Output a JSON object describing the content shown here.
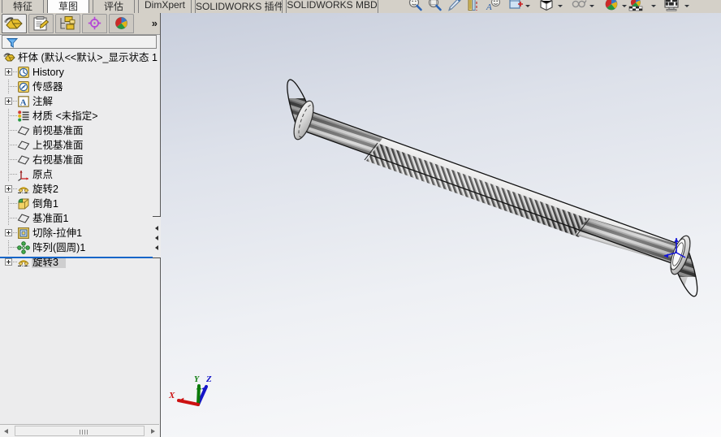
{
  "app": {
    "name": "SOLIDWORKS",
    "document_title": "杆体"
  },
  "command_tabs": [
    {
      "label": "特征",
      "active": false
    },
    {
      "label": "草图",
      "active": true
    },
    {
      "label": "评估",
      "active": false
    },
    {
      "label": "DimXpert",
      "active": false
    },
    {
      "label": "SOLIDWORKS 插件",
      "active": false
    },
    {
      "label": "SOLIDWORKS MBD",
      "active": false
    }
  ],
  "view_toolbar": [
    {
      "name": "zoom-to-fit-icon"
    },
    {
      "name": "zoom-to-area-icon"
    },
    {
      "name": "zoom-in-out-icon"
    },
    {
      "name": "section-view-icon"
    },
    {
      "name": "view-orientation-icon"
    },
    {
      "name": "display-style-icon",
      "has_dropdown": true
    },
    {
      "name": "hide-show-items-icon",
      "has_dropdown": true
    },
    {
      "name": "edit-appearance-icon",
      "has_dropdown": true
    },
    {
      "name": "apply-scene-icon",
      "has_dropdown": true
    },
    {
      "name": "view-settings-icon",
      "has_dropdown": true
    }
  ],
  "manager_tabs": [
    {
      "name": "feature-manager-tab",
      "selected": true
    },
    {
      "name": "property-manager-tab",
      "selected": false
    },
    {
      "name": "configuration-manager-tab",
      "selected": false
    },
    {
      "name": "dimxpert-manager-tab",
      "selected": false
    },
    {
      "name": "display-manager-tab",
      "selected": false
    }
  ],
  "manager_overflow_label": "»",
  "filter": {
    "value": "",
    "placeholder": ""
  },
  "tree": {
    "root": {
      "label": "杆体  (默认<<默认>_显示状态 1",
      "icon": "part-icon"
    },
    "items": [
      {
        "label": "History",
        "icon": "history-icon",
        "expandable": true,
        "depth": 1
      },
      {
        "label": "传感器",
        "icon": "sensors-icon",
        "expandable": false,
        "depth": 1
      },
      {
        "label": "注解",
        "icon": "annotations-icon",
        "expandable": true,
        "depth": 1
      },
      {
        "label": "材质 <未指定>",
        "icon": "material-icon",
        "expandable": false,
        "depth": 1
      },
      {
        "label": "前视基准面",
        "icon": "plane-icon",
        "expandable": false,
        "depth": 1
      },
      {
        "label": "上视基准面",
        "icon": "plane-icon",
        "expandable": false,
        "depth": 1
      },
      {
        "label": "右视基准面",
        "icon": "plane-icon",
        "expandable": false,
        "depth": 1
      },
      {
        "label": "原点",
        "icon": "origin-icon",
        "expandable": false,
        "depth": 1
      },
      {
        "label": "旋转2",
        "icon": "revolve-icon",
        "expandable": true,
        "depth": 1
      },
      {
        "label": "倒角1",
        "icon": "chamfer-icon",
        "expandable": false,
        "depth": 1
      },
      {
        "label": "基准面1",
        "icon": "plane-icon",
        "expandable": false,
        "depth": 1
      },
      {
        "label": "切除-拉伸1",
        "icon": "extrude-cut-icon",
        "expandable": true,
        "depth": 1
      },
      {
        "label": "阵列(圆周)1",
        "icon": "circular-pattern-icon",
        "expandable": false,
        "depth": 1
      },
      {
        "label": "旋转3",
        "icon": "revolve-icon",
        "expandable": true,
        "depth": 1,
        "selected": true
      }
    ]
  },
  "graphics": {
    "model_name": "杆体",
    "model_description": "threaded-rod-with-knurled-shaft",
    "triad": {
      "x_label": "X",
      "y_label": "Y",
      "z_label": "Z",
      "x_color": "#cc0000",
      "y_color": "#007700",
      "z_color": "#0000cc"
    },
    "background_top": "#c8cedc",
    "background_bottom": "#fbfbfc"
  },
  "splitter": {
    "name": "panel-collapse-handle",
    "arrow_count": 3
  },
  "scrollbar": {
    "left_arrow": "◄",
    "right_arrow": "►"
  }
}
